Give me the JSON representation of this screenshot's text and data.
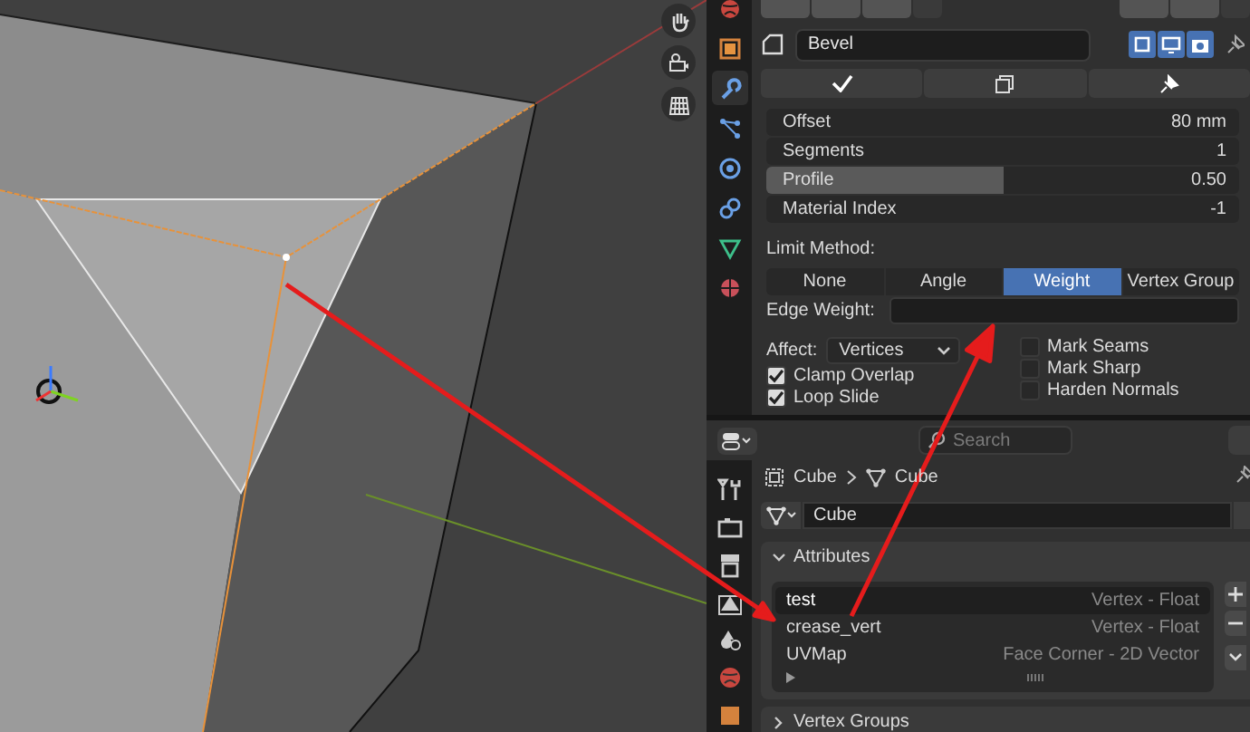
{
  "top_editor": {
    "tabs": [
      {
        "selected": false
      },
      {
        "selected": false
      },
      {
        "selected": true
      },
      {
        "selected": false
      },
      {
        "selected": false
      },
      {
        "selected": false
      },
      {
        "selected": false
      },
      {
        "selected": false
      }
    ],
    "modifier": {
      "name": "Bevel",
      "toggles": [
        {
          "on": true
        },
        {
          "on": true
        },
        {
          "on": true
        }
      ],
      "fields": [
        {
          "label": "Offset",
          "value": "80 mm"
        },
        {
          "label": "Segments",
          "value": "1"
        },
        {
          "label": "Profile",
          "value": "0.50",
          "level": 0.5
        },
        {
          "label": "Material Index",
          "value": "-1"
        }
      ],
      "limit_method": {
        "label": "Limit Method:",
        "options": [
          {
            "label": "None",
            "selected": false
          },
          {
            "label": "Angle",
            "selected": false
          },
          {
            "label": "Weight",
            "selected": true
          },
          {
            "label": "Vertex Group",
            "selected": false
          }
        ]
      },
      "edge_weight": {
        "label": "Edge Weight:"
      },
      "affect": {
        "label": "Affect:",
        "value": "Vertices"
      },
      "options_left": [
        {
          "label": "Clamp Overlap",
          "checked": true
        },
        {
          "label": "Loop Slide",
          "checked": true
        }
      ],
      "options_right": [
        {
          "label": "Mark Seams",
          "checked": false
        },
        {
          "label": "Mark Sharp",
          "checked": false
        },
        {
          "label": "Harden Normals",
          "checked": false
        }
      ]
    }
  },
  "bottom_editor": {
    "search": {
      "placeholder": "Search"
    },
    "tabs": [
      {
        "selected": false
      },
      {
        "selected": false
      },
      {
        "selected": false
      },
      {
        "selected": false
      },
      {
        "selected": false
      },
      {
        "selected": false
      },
      {
        "selected": false
      }
    ],
    "breadcrumb": [
      "Cube",
      "Cube"
    ],
    "mesh_name": "Cube",
    "panels": [
      {
        "title": "Attributes",
        "expanded": true,
        "rows": [
          {
            "name": "test",
            "type": "Vertex - Float",
            "selected": true
          },
          {
            "name": "crease_vert",
            "type": "Vertex - Float",
            "selected": false
          },
          {
            "name": "UVMap",
            "type": "Face Corner - 2D Vector",
            "selected": false
          }
        ]
      },
      {
        "title": "Vertex Groups",
        "expanded": false
      }
    ]
  }
}
